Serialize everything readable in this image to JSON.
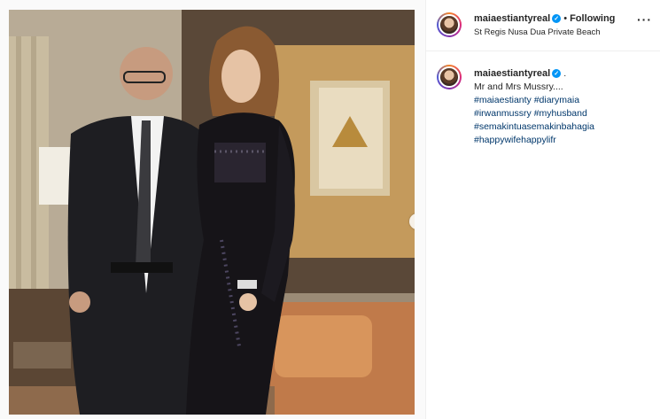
{
  "post": {
    "username": "maiaestiantyreal",
    "follow_status": "Following",
    "location": "St Regis Nusa Dua Private Beach",
    "separator": "•",
    "more_icon": "more-horizontal-icon",
    "verified_icon": "verified-badge-icon"
  },
  "caption": {
    "username": "maiaestiantyreal",
    "suffix": ".",
    "text": "Mr and Mrs Mussry....",
    "hashtags": [
      "#maiaestianty #diarymaia",
      "#irwanmussry #myhusband",
      "#semakintuasemakinbahagia",
      "#happywifehappylifr"
    ]
  },
  "carousel": {
    "next_icon": "chevron-right-icon",
    "active_index": 1,
    "count": 2
  },
  "colors": {
    "link": "#00376b",
    "accent": "#0095f6",
    "border": "#efefef"
  }
}
